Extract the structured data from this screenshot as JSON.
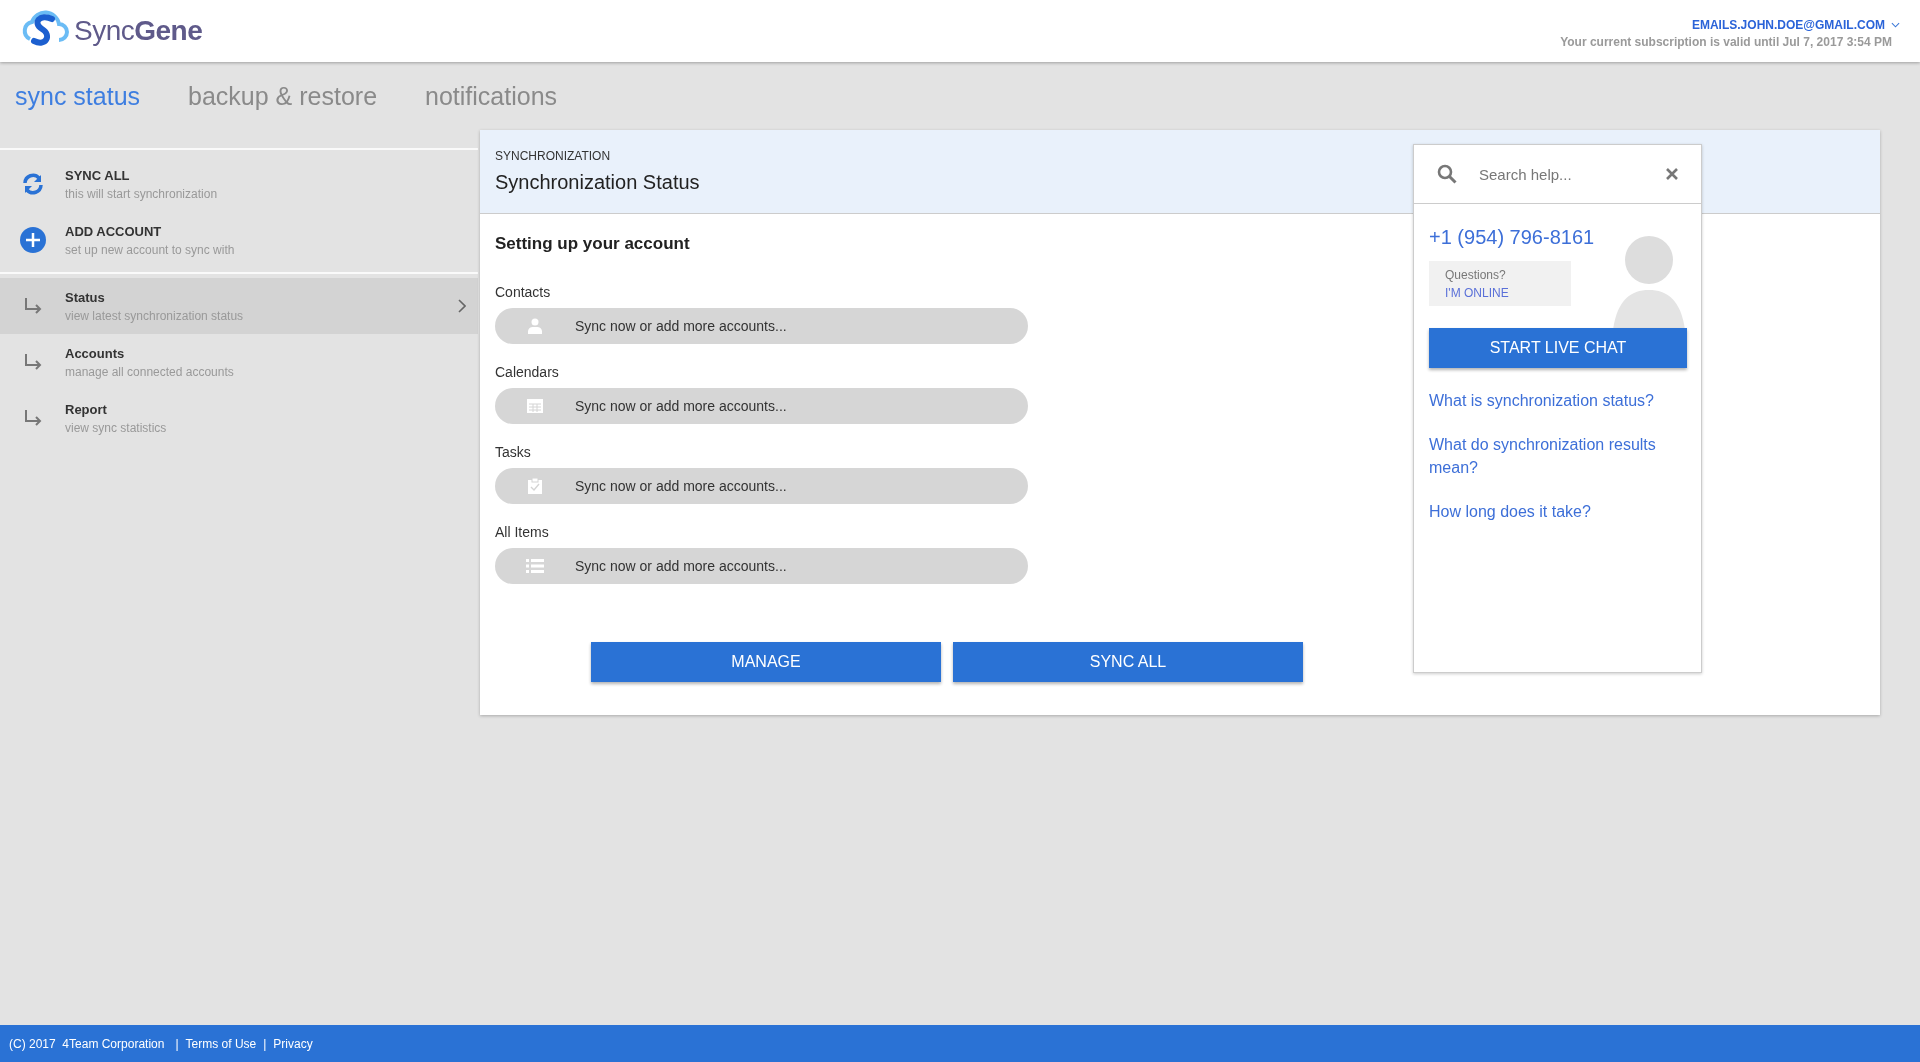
{
  "header": {
    "logo": "Sync**Gene**",
    "account_email": "EMAILS.JOHN.DOE@GMAIL.COM",
    "subscription": "Your current subscription is valid until Jul 7, 2017 3:54 PM"
  },
  "tabs": [
    {
      "label": "sync status",
      "selected": true
    },
    {
      "label": "backup & restore",
      "selected": false
    },
    {
      "label": "notifications",
      "selected": false
    }
  ],
  "sidebar": {
    "actions": [
      {
        "kind": "sync",
        "title": "SYNC ALL",
        "subtitle": "this will start synchronization"
      },
      {
        "kind": "add",
        "title": "ADD ACCOUNT",
        "subtitle": "set up new account to sync with"
      }
    ],
    "items": [
      {
        "title": "Status",
        "subtitle": "view latest synchronization status",
        "selected": true
      },
      {
        "title": "Accounts",
        "subtitle": "manage all connected accounts",
        "selected": false
      },
      {
        "title": "Report",
        "subtitle": "view sync statistics",
        "selected": false
      }
    ]
  },
  "panel": {
    "overline": "SYNCHRONIZATION",
    "title": "Synchronization Status",
    "section_title": "Setting up your account",
    "categories": [
      {
        "kind": "contacts",
        "label": "Contacts",
        "status": "Sync now or add more accounts..."
      },
      {
        "kind": "calendars",
        "label": "Calendars",
        "status": "Sync now or add more accounts..."
      },
      {
        "kind": "tasks",
        "label": "Tasks",
        "status": "Sync now or add more accounts..."
      },
      {
        "kind": "all",
        "label": "All Items",
        "status": "Sync now or add more accounts..."
      }
    ],
    "buttons": [
      "MANAGE",
      "SYNC ALL"
    ]
  },
  "help": {
    "search": {
      "placeholder": "Search help..."
    },
    "phone": "+1 (954) 796-8161",
    "bubble_question": "Questions?",
    "bubble_status": "I'M ONLINE",
    "chat_button": "START LIVE CHAT",
    "links": [
      "What is synchronization status?",
      "What do synchronization results mean?",
      "How long does it take?"
    ]
  },
  "footer": {
    "copyright": "(C) 2017  4Team Corporation",
    "separator": "|",
    "links": [
      "Terms of Use",
      "Privacy"
    ]
  }
}
